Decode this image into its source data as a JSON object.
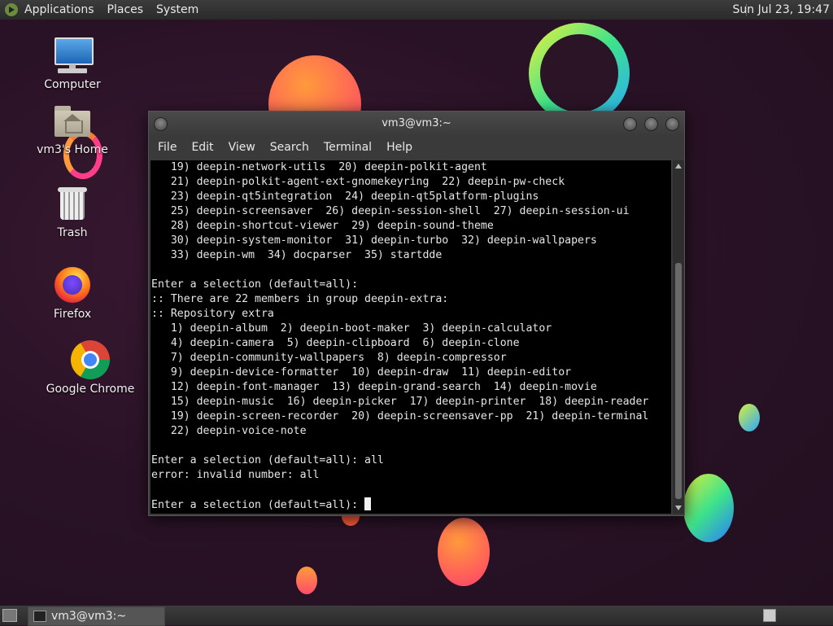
{
  "top_panel": {
    "menus": [
      "Applications",
      "Places",
      "System"
    ],
    "clock": "Sun Jul 23, 19:47"
  },
  "desktop_icons": [
    {
      "label": "Computer",
      "icon": "computer-icon"
    },
    {
      "label": "vm3's Home",
      "icon": "home-folder-icon"
    },
    {
      "label": "Trash",
      "icon": "trash-icon"
    },
    {
      "label": "Firefox",
      "icon": "firefox-icon"
    },
    {
      "label": "Google Chrome",
      "icon": "chrome-icon"
    }
  ],
  "terminal": {
    "title": "vm3@vm3:~",
    "menus": [
      "File",
      "Edit",
      "View",
      "Search",
      "Terminal",
      "Help"
    ],
    "lines": [
      "   19) deepin-network-utils  20) deepin-polkit-agent",
      "   21) deepin-polkit-agent-ext-gnomekeyring  22) deepin-pw-check",
      "   23) deepin-qt5integration  24) deepin-qt5platform-plugins",
      "   25) deepin-screensaver  26) deepin-session-shell  27) deepin-session-ui",
      "   28) deepin-shortcut-viewer  29) deepin-sound-theme",
      "   30) deepin-system-monitor  31) deepin-turbo  32) deepin-wallpapers",
      "   33) deepin-wm  34) docparser  35) startdde",
      "",
      "Enter a selection (default=all):",
      ":: There are 22 members in group deepin-extra:",
      ":: Repository extra",
      "   1) deepin-album  2) deepin-boot-maker  3) deepin-calculator",
      "   4) deepin-camera  5) deepin-clipboard  6) deepin-clone",
      "   7) deepin-community-wallpapers  8) deepin-compressor",
      "   9) deepin-device-formatter  10) deepin-draw  11) deepin-editor",
      "   12) deepin-font-manager  13) deepin-grand-search  14) deepin-movie",
      "   15) deepin-music  16) deepin-picker  17) deepin-printer  18) deepin-reader",
      "   19) deepin-screen-recorder  20) deepin-screensaver-pp  21) deepin-terminal",
      "   22) deepin-voice-note",
      "",
      "Enter a selection (default=all): all",
      "error: invalid number: all",
      ""
    ],
    "prompt": "Enter a selection (default=all): "
  },
  "bottom_panel": {
    "task_label": "vm3@vm3:~"
  }
}
